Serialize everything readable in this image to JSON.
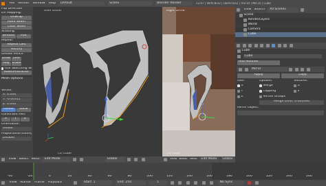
{
  "info_bar": {
    "menus": [
      "File",
      "Render",
      "Window",
      "Help"
    ],
    "layout": "Default",
    "scene": "Scene",
    "engine": "Blender Render",
    "stats": "v2.67 | Verts:8/32 | Faces:0/22 | Tris:10 | Mo:10 | Cube"
  },
  "tool_shelf": {
    "items": [
      "Flip Direction",
      "UV Mapping:",
      "Unwrap",
      "Mark Seam",
      "Clear Seam",
      "Shading:",
      "Smooth",
      "Flat",
      "Repeat:",
      "Repeat Last",
      "History",
      "Grease Pencil:",
      "Draw",
      "Line",
      "Poly",
      "Erase",
      "Use Sketching Sessi",
      "Ruler/Protractor"
    ],
    "mesh_options": "Mesh Options",
    "vertex": {
      "title": "Vertex",
      "x": "X: 0.000",
      "y": "Y: -0.00311",
      "z": "Z: 0.000",
      "global": "Global",
      "local": "Local"
    },
    "constraint_axis": "Constraint Axis",
    "axes": [
      "X",
      "Y",
      "Z"
    ],
    "orientation": "Orientation",
    "orientation_value": "Global",
    "proportional": "Proportional Editing",
    "proportional_value": "Disable"
  },
  "viewport_left": {
    "title": "User Ortho",
    "object": "(1) Cube"
  },
  "viewport_right": {
    "title": "Right Ortho",
    "object": "(1) Cube"
  },
  "view_header": {
    "items": [
      "View",
      "Select",
      "Mesh",
      "Edit Mode",
      "Global"
    ]
  },
  "view_header_right": {
    "items": [
      "View",
      "Select",
      "Mesh",
      "Edit Mode",
      "Global"
    ]
  },
  "outliner": {
    "tabs": [
      "View",
      "Search",
      "All Scenes"
    ],
    "items": [
      "Scene",
      "RenderLayers",
      "World",
      "Camera",
      "Cube",
      "Lamp"
    ]
  },
  "properties": {
    "breadcrumb": "Cube",
    "object_name": "Cube",
    "add_modifier": "Add Modifier",
    "modifier_name": "Mirror",
    "apply": "Apply",
    "copy": "Copy",
    "axis_header": "Axis:",
    "options_header": "Options:",
    "textures_header": "Textures:",
    "axis": [
      "X",
      "Y",
      "Z"
    ],
    "options": [
      "Merge",
      "Clipping",
      "Vertex Groups"
    ],
    "textures": [
      "U",
      "V"
    ],
    "merge_limit": "Merge Limit: 0.001000",
    "mirror_object": "Mirror Object:"
  },
  "timeline": {
    "ticks": [
      "-40",
      "-20",
      "0",
      "20",
      "40",
      "60",
      "80",
      "100",
      "120",
      "140",
      "160",
      "180",
      "200",
      "220",
      "240",
      "260"
    ],
    "menus": [
      "View",
      "Marker",
      "Frame",
      "Playback"
    ],
    "start": "Start: 1",
    "end": "End: 250",
    "current": "1",
    "sync": "No Sync"
  },
  "colors": {
    "selected_vertex": "#f5a020",
    "edge_select": "#f0c040",
    "background": "#3d3d3d",
    "panel": "#434343"
  }
}
